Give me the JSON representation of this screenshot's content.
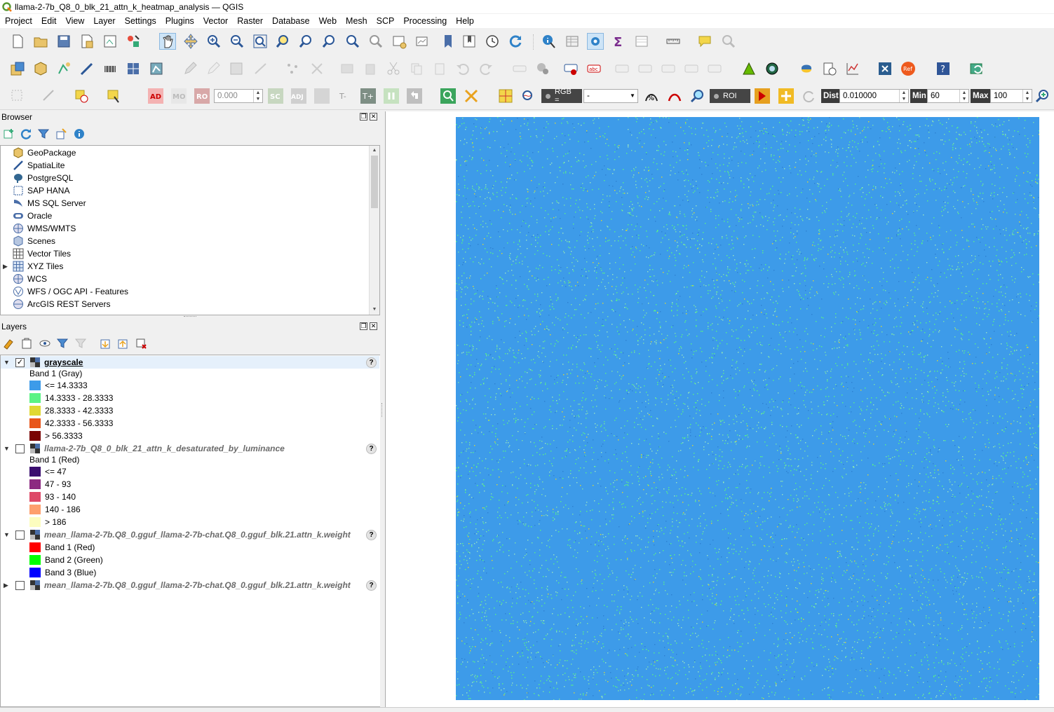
{
  "window": {
    "title": "llama-2-7b_Q8_0_blk_21_attn_k_heatmap_analysis — QGIS"
  },
  "menu": [
    "Project",
    "Edit",
    "View",
    "Layer",
    "Settings",
    "Plugins",
    "Vector",
    "Raster",
    "Database",
    "Web",
    "Mesh",
    "SCP",
    "Processing",
    "Help"
  ],
  "toolbar3": {
    "ad_label": "AD",
    "mo_label": "MO",
    "ro_label": "RO",
    "value": "0.000",
    "sc_label": "SC",
    "adj_label": "ADJ",
    "t_minus": "T-",
    "t_plus": "T+",
    "rgb_label": "RGB =",
    "rgb_value": "-",
    "roi_label": "ROI",
    "dist_label": "Dist",
    "dist_value": "0.010000",
    "min_label": "Min",
    "min_value": "60",
    "max_label": "Max",
    "max_value": "100",
    "ref_label": "Ref"
  },
  "browser": {
    "title": "Browser",
    "items": [
      {
        "label": "GeoPackage",
        "icon": "geopackage-icon"
      },
      {
        "label": "SpatiaLite",
        "icon": "spatialite-icon"
      },
      {
        "label": "PostgreSQL",
        "icon": "postgresql-icon"
      },
      {
        "label": "SAP HANA",
        "icon": "sap-hana-icon"
      },
      {
        "label": "MS SQL Server",
        "icon": "mssql-icon"
      },
      {
        "label": "Oracle",
        "icon": "oracle-icon"
      },
      {
        "label": "WMS/WMTS",
        "icon": "wms-icon"
      },
      {
        "label": "Scenes",
        "icon": "scenes-icon"
      },
      {
        "label": "Vector Tiles",
        "icon": "vector-tiles-icon"
      },
      {
        "label": "XYZ Tiles",
        "icon": "xyz-tiles-icon"
      },
      {
        "label": "WCS",
        "icon": "wcs-icon"
      },
      {
        "label": "WFS / OGC API - Features",
        "icon": "wfs-icon"
      },
      {
        "label": "ArcGIS REST Servers",
        "icon": "arcgis-icon"
      }
    ]
  },
  "layers": {
    "title": "Layers",
    "list": [
      {
        "name": "grayscale",
        "checked": true,
        "band": "Band 1 (Gray)",
        "legend": [
          {
            "label": "<= 14.3333",
            "color": "#3d9be9"
          },
          {
            "label": "14.3333 - 28.3333",
            "color": "#5af384"
          },
          {
            "label": "28.3333 - 42.3333",
            "color": "#e0d833"
          },
          {
            "label": "42.3333 - 56.3333",
            "color": "#e8561a"
          },
          {
            "label": "> 56.3333",
            "color": "#7a0403"
          }
        ]
      },
      {
        "name": "llama-2-7b_Q8_0_blk_21_attn_k_desaturated_by_luminance",
        "checked": false,
        "band": "Band 1 (Red)",
        "legend": [
          {
            "label": "<= 47",
            "color": "#3b0f70"
          },
          {
            "label": "47 - 93",
            "color": "#8c2981"
          },
          {
            "label": "93 - 140",
            "color": "#de4968"
          },
          {
            "label": "140 - 186",
            "color": "#fe9f6d"
          },
          {
            "label": "> 186",
            "color": "#fcfdbf"
          }
        ]
      },
      {
        "name": "mean_llama-2-7b.Q8_0.gguf_llama-2-7b-chat.Q8_0.gguf_blk.21.attn_k.weight",
        "checked": false,
        "legend": [
          {
            "label": "Band 1 (Red)",
            "color": "#ff0000"
          },
          {
            "label": "Band 2 (Green)",
            "color": "#00ff00"
          },
          {
            "label": "Band 3 (Blue)",
            "color": "#0000ff"
          }
        ]
      },
      {
        "name": "mean_llama-2-7b.Q8_0.gguf_llama-2-7b-chat.Q8_0.gguf_blk.21.attn_k.weight",
        "checked": false
      }
    ]
  },
  "map": {
    "raster_base_color": "#3d9be9"
  }
}
